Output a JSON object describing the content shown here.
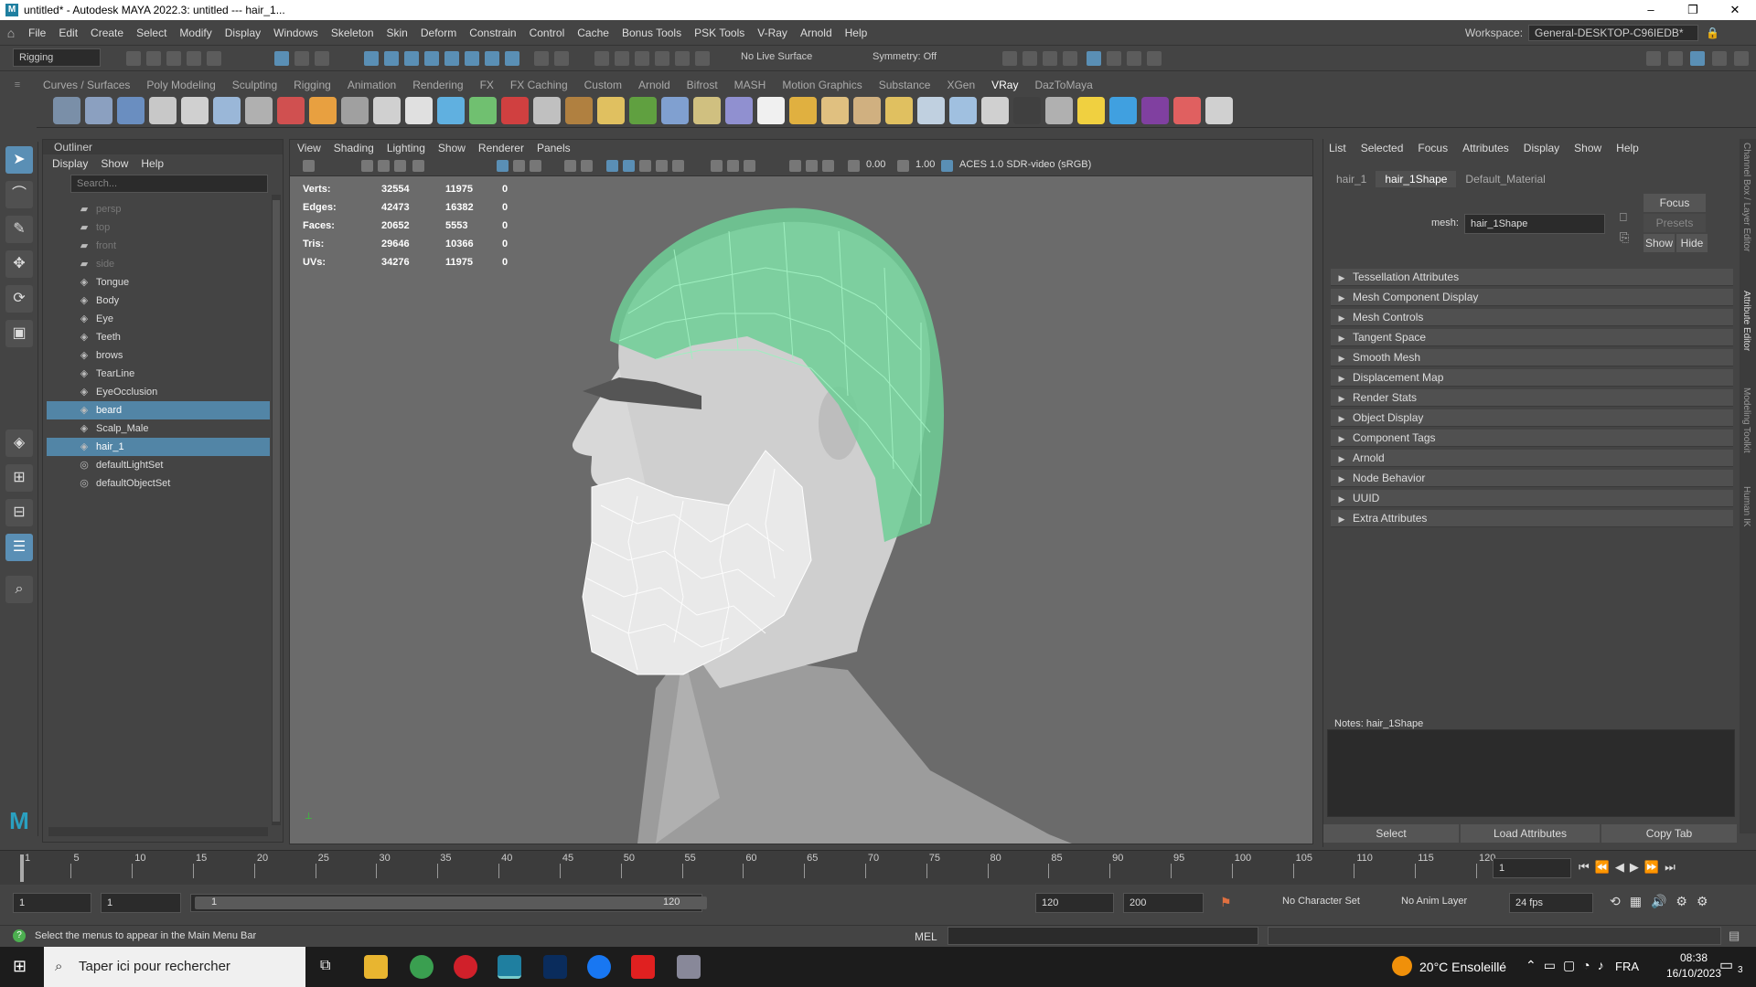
{
  "window": {
    "title": "untitled* - Autodesk MAYA 2022.3: untitled   ---   hair_1...",
    "logo": "M",
    "controls": [
      "–",
      "❐",
      "✕"
    ]
  },
  "menubar": {
    "items": [
      "File",
      "Edit",
      "Create",
      "Select",
      "Modify",
      "Display",
      "Windows",
      "Skeleton",
      "Skin",
      "Deform",
      "Constrain",
      "Control",
      "Cache",
      "Bonus Tools",
      "PSK Tools",
      "V-Ray",
      "Arnold",
      "Help"
    ],
    "workspace_label": "Workspace:",
    "workspace_value": "General-DESKTOP-C96IEDB*"
  },
  "toolbar": {
    "menu_set": "Rigging",
    "live_surface": "No Live Surface",
    "symmetry": "Symmetry: Off"
  },
  "shelf": {
    "tabs": [
      "Curves / Surfaces",
      "Poly Modeling",
      "Sculpting",
      "Rigging",
      "Animation",
      "Rendering",
      "FX",
      "FX Caching",
      "Custom",
      "Arnold",
      "Bifrost",
      "MASH",
      "Motion Graphics",
      "Substance",
      "XGen",
      "VRay",
      "DazToMaya"
    ],
    "active_tab": "VRay",
    "icon_colors": [
      "#7a8fa8",
      "#8ba0c0",
      "#6a8ec0",
      "#c8c8c8",
      "#d0d0d0",
      "#9ab7d8",
      "#b0b0b0",
      "#d05050",
      "#e8a040",
      "#a0a0a0",
      "#d0d0d0",
      "#e0e0e0",
      "#60b0e0",
      "#70c070",
      "#d04040",
      "#c0c0c0",
      "#b08040",
      "#e0c060",
      "#60a040",
      "#80a0d0",
      "#d0c080",
      "#9090d0",
      "#f0f0f0",
      "#e0b040",
      "#e0c080",
      "#d0b080",
      "#e0c060",
      "#c0d0e0",
      "#a0c0e0",
      "#d0d0d0",
      "#404040",
      "#b0b0b0",
      "#f0d040",
      "#40a0e0",
      "#8040a0",
      "#e06060",
      "#d0d0d0"
    ]
  },
  "outliner": {
    "title": "Outliner",
    "menu": [
      "Display",
      "Show",
      "Help"
    ],
    "search_placeholder": "Search...",
    "items": [
      {
        "label": "persp",
        "icon": "camera",
        "dim": true,
        "sel": false
      },
      {
        "label": "top",
        "icon": "camera",
        "dim": true,
        "sel": false
      },
      {
        "label": "front",
        "icon": "camera",
        "dim": true,
        "sel": false
      },
      {
        "label": "side",
        "icon": "camera",
        "dim": true,
        "sel": false
      },
      {
        "label": "Tongue",
        "icon": "mesh",
        "dim": false,
        "sel": false
      },
      {
        "label": "Body",
        "icon": "mesh",
        "dim": false,
        "sel": false
      },
      {
        "label": "Eye",
        "icon": "mesh",
        "dim": false,
        "sel": false
      },
      {
        "label": "Teeth",
        "icon": "mesh",
        "dim": false,
        "sel": false
      },
      {
        "label": "brows",
        "icon": "mesh",
        "dim": false,
        "sel": false
      },
      {
        "label": "TearLine",
        "icon": "mesh",
        "dim": false,
        "sel": false
      },
      {
        "label": "EyeOcclusion",
        "icon": "mesh",
        "dim": false,
        "sel": false
      },
      {
        "label": "beard",
        "icon": "mesh",
        "dim": false,
        "sel": true
      },
      {
        "label": "Scalp_Male",
        "icon": "mesh",
        "dim": false,
        "sel": false
      },
      {
        "label": "hair_1",
        "icon": "mesh",
        "dim": false,
        "sel": true
      },
      {
        "label": "defaultLightSet",
        "icon": "set",
        "dim": false,
        "sel": false
      },
      {
        "label": "defaultObjectSet",
        "icon": "set",
        "dim": false,
        "sel": false
      }
    ]
  },
  "viewport": {
    "menu": [
      "View",
      "Shading",
      "Lighting",
      "Show",
      "Renderer",
      "Panels"
    ],
    "exposure": "0.00",
    "gamma": "1.00",
    "color_space": "ACES 1.0 SDR-video (sRGB)",
    "hud": [
      {
        "label": "Verts:",
        "a": "32554",
        "b": "11975",
        "c": "0"
      },
      {
        "label": "Edges:",
        "a": "42473",
        "b": "16382",
        "c": "0"
      },
      {
        "label": "Faces:",
        "a": "20652",
        "b": "5553",
        "c": "0"
      },
      {
        "label": "Tris:",
        "a": "29646",
        "b": "10366",
        "c": "0"
      },
      {
        "label": "UVs:",
        "a": "34276",
        "b": "11975",
        "c": "0"
      }
    ]
  },
  "attribute_editor": {
    "menu": [
      "List",
      "Selected",
      "Focus",
      "Attributes",
      "Display",
      "Show",
      "Help"
    ],
    "tabs": [
      "hair_1",
      "hair_1Shape",
      "Default_Material"
    ],
    "active_tab": "hair_1Shape",
    "mesh_label": "mesh:",
    "mesh_value": "hair_1Shape",
    "focus": "Focus",
    "presets": "Presets",
    "show": "Show",
    "hide": "Hide",
    "sections": [
      "Tessellation Attributes",
      "Mesh Component Display",
      "Mesh Controls",
      "Tangent Space",
      "Smooth Mesh",
      "Displacement Map",
      "Render Stats",
      "Object Display",
      "Component Tags",
      "Arnold",
      "Node Behavior",
      "UUID",
      "Extra Attributes"
    ],
    "notes_label": "Notes:  hair_1Shape",
    "buttons": [
      "Select",
      "Load Attributes",
      "Copy Tab"
    ]
  },
  "side_tabs": [
    "Channel Box / Layer Editor",
    "Attribute Editor",
    "Modeling Toolkit",
    "Human IK"
  ],
  "timeline": {
    "ticks": [
      "1",
      "5",
      "10",
      "15",
      "20",
      "25",
      "30",
      "35",
      "40",
      "45",
      "50",
      "55",
      "60",
      "65",
      "70",
      "75",
      "80",
      "85",
      "90",
      "95",
      "100",
      "105",
      "110",
      "115",
      "120"
    ],
    "current_frame": "1"
  },
  "range": {
    "start": "1",
    "start2": "1",
    "slider_start": "1",
    "slider_end": "120",
    "end": "120",
    "end2": "200",
    "character_set": "No Character Set",
    "anim_layer": "No Anim Layer",
    "fps": "24 fps"
  },
  "command_line": {
    "help": "Select the menus to appear in the Main Menu Bar",
    "lang": "MEL"
  },
  "taskbar": {
    "search": "Taper ici pour rechercher",
    "weather": "20°C  Ensoleillé",
    "lang": "FRA",
    "time": "08:38",
    "date": "16/10/2023",
    "notif": "3"
  }
}
